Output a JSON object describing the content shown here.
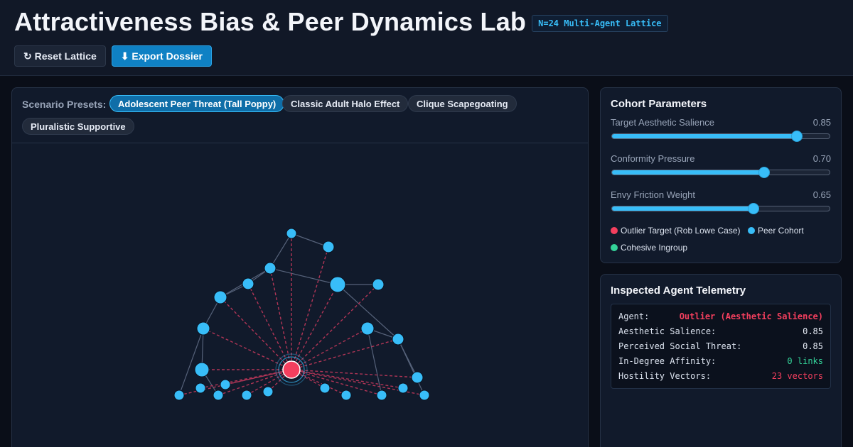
{
  "header": {
    "title": "Attractiveness Bias & Peer Dynamics Lab",
    "badge": "N=24 Multi-Agent Lattice",
    "buttons": {
      "reset": "↻ Reset Lattice",
      "export": "⬇ Export Dossier"
    }
  },
  "presets": {
    "label": "Scenario Presets:",
    "items": [
      "Adolescent Peer Threat (Tall Poppy)",
      "Classic Adult Halo Effect",
      "Clique Scapegoating",
      "Pluralistic Supportive"
    ],
    "active_index": 0
  },
  "cohort": {
    "title": "Cohort Parameters",
    "sliders": [
      {
        "label": "Target Aesthetic Salience",
        "value": "0.85",
        "fraction": 0.85
      },
      {
        "label": "Conformity Pressure",
        "value": "0.70",
        "fraction": 0.7
      },
      {
        "label": "Envy Friction Weight",
        "value": "0.65",
        "fraction": 0.65
      }
    ],
    "legend": [
      {
        "label": "Outlier Target (Rob Lowe Case)",
        "color": "#f43f5e"
      },
      {
        "label": "Peer Cohort",
        "color": "#38bdf8"
      },
      {
        "label": "Cohesive Ingroup",
        "color": "#34d399"
      }
    ]
  },
  "telemetry": {
    "title": "Inspected Agent Telemetry",
    "rows": [
      {
        "key": "Agent:",
        "value": "Outlier (Aesthetic Salience)",
        "color": "#f43f5e",
        "bold": true
      },
      {
        "key": "Aesthetic Salience:",
        "value": "0.85",
        "color": "#e6ebf5",
        "bold": false
      },
      {
        "key": "Perceived Social Threat:",
        "value": "0.85",
        "color": "#e6ebf5",
        "bold": false
      },
      {
        "key": "In-Degree Affinity:",
        "value": "0 links",
        "color": "#34d399",
        "bold": false
      },
      {
        "key": "Hostility Vectors:",
        "value": "23 vectors",
        "color": "#f43f5e",
        "bold": false
      }
    ]
  },
  "colors": {
    "outlier": "#f43f5e",
    "peer": "#38bdf8",
    "accent": "#0f81c4",
    "hostile_edge": "#b03556",
    "peer_edge": "#56627a"
  }
}
